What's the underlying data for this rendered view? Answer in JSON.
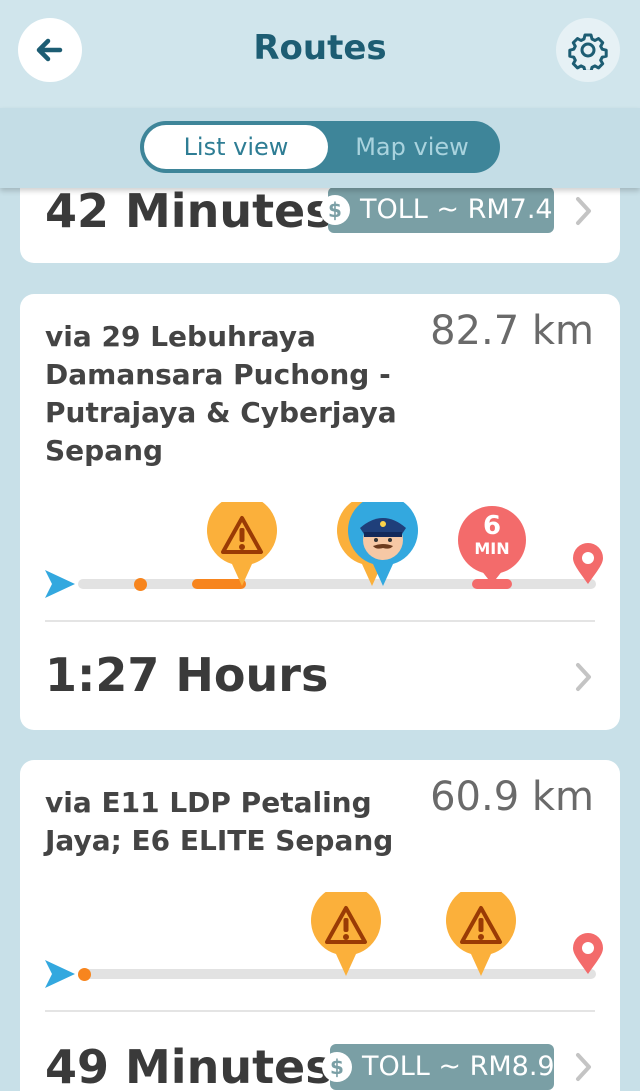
{
  "header": {
    "title": "Routes"
  },
  "view_toggle": {
    "list_label": "List view",
    "map_label": "Map view",
    "selected": "List view"
  },
  "routes": [
    {
      "time": "42 Minutes",
      "toll": "TOLL ~ RM7.40",
      "toll_icon": "$"
    },
    {
      "via": "via 29 Lebuhraya Damansara Puchong - Putrajaya & Cyberjaya Sepang",
      "distance": "82.7 km",
      "time": "1:27 Hours",
      "delay_badge": {
        "value": "6",
        "unit": "MIN"
      },
      "markers": [
        "start-arrow-icon",
        "hazard-icon",
        "police-icon",
        "delay-badge",
        "destination-pin-icon"
      ]
    },
    {
      "via": "via E11 LDP Petaling Jaya; E6 ELITE Sepang",
      "distance": "60.9 km",
      "time": "49 Minutes",
      "toll": "TOLL ~ RM8.90",
      "toll_icon": "$",
      "markers": [
        "start-arrow-icon",
        "hazard-icon",
        "hazard-icon",
        "destination-pin-icon"
      ]
    }
  ],
  "colors": {
    "accent": "#1d5d73",
    "toggle": "#3e8599",
    "hazard": "#fbb03b",
    "jam": "#f36b6b",
    "traffic": "#f7851e",
    "start": "#33a8df"
  }
}
